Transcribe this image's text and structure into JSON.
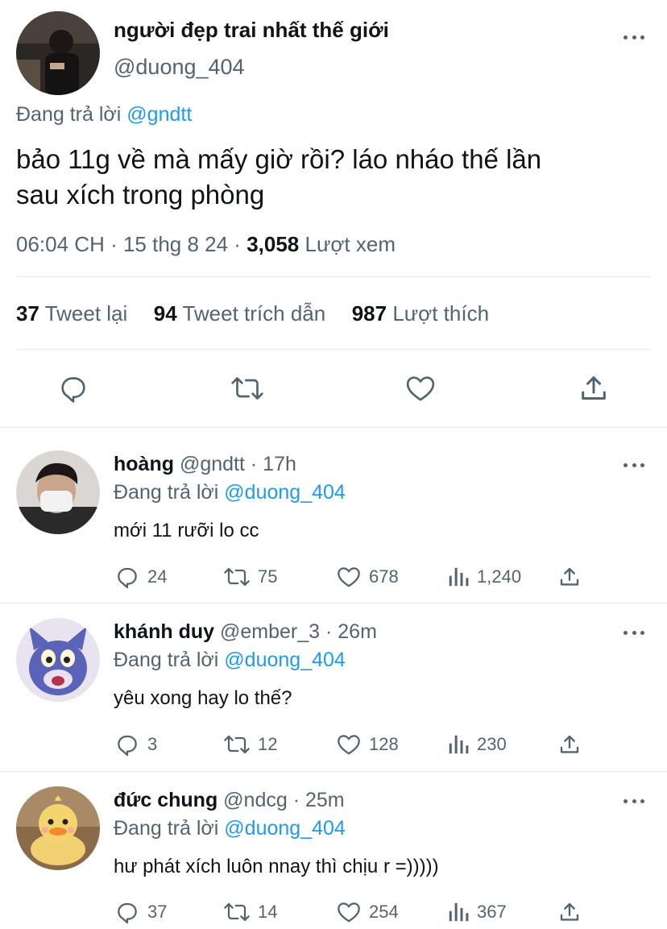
{
  "main_tweet": {
    "display_name": "người đẹp trai nhất thế giới",
    "handle": "@duong_404",
    "replying_label": "Đang trả lời",
    "replying_to": "@gndtt",
    "text_line1": "bảo 11g về mà mấy giờ rồi? láo nháo thế lần",
    "text_line2": "sau xích trong phòng",
    "time": "06:04 CH · 15 thg 8 24 ·",
    "views_count": "3,058",
    "views_label": "Lượt xem",
    "stats": {
      "retweets_count": "37",
      "retweets_label": "Tweet lại",
      "quotes_count": "94",
      "quotes_label": "Tweet trích dẫn",
      "likes_count": "987",
      "likes_label": "Lượt thích"
    }
  },
  "replies": [
    {
      "name": "hoàng",
      "handle": "@gndtt",
      "time": "· 17h",
      "replying_label": "Đang trả lời",
      "replying_to": "@duong_404",
      "text": "mới 11 rưỡi lo cc",
      "reply_count": "24",
      "retweet_count": "75",
      "like_count": "678",
      "view_count": "1,240"
    },
    {
      "name": "khánh duy",
      "handle": "@ember_3",
      "time": "· 26m",
      "replying_label": "Đang trả lời",
      "replying_to": "@duong_404",
      "text": "yêu xong hay lo thế?",
      "reply_count": "3",
      "retweet_count": "12",
      "like_count": "128",
      "view_count": "230"
    },
    {
      "name": "đức chung",
      "handle": "@ndcg",
      "time": "· 25m",
      "replying_label": "Đang trả lời",
      "replying_to": "@duong_404",
      "text": "hư phát xích luôn nnay thì chịu r =)))))",
      "reply_count": "37",
      "retweet_count": "14",
      "like_count": "254",
      "view_count": "367"
    }
  ],
  "colors": {
    "link": "#1d9bf0",
    "muted": "#536471",
    "text": "#0f1419",
    "divider": "#e6e9eb"
  },
  "icons": [
    "reply-icon",
    "retweet-icon",
    "like-icon",
    "share-icon",
    "views-icon",
    "more-icon"
  ]
}
